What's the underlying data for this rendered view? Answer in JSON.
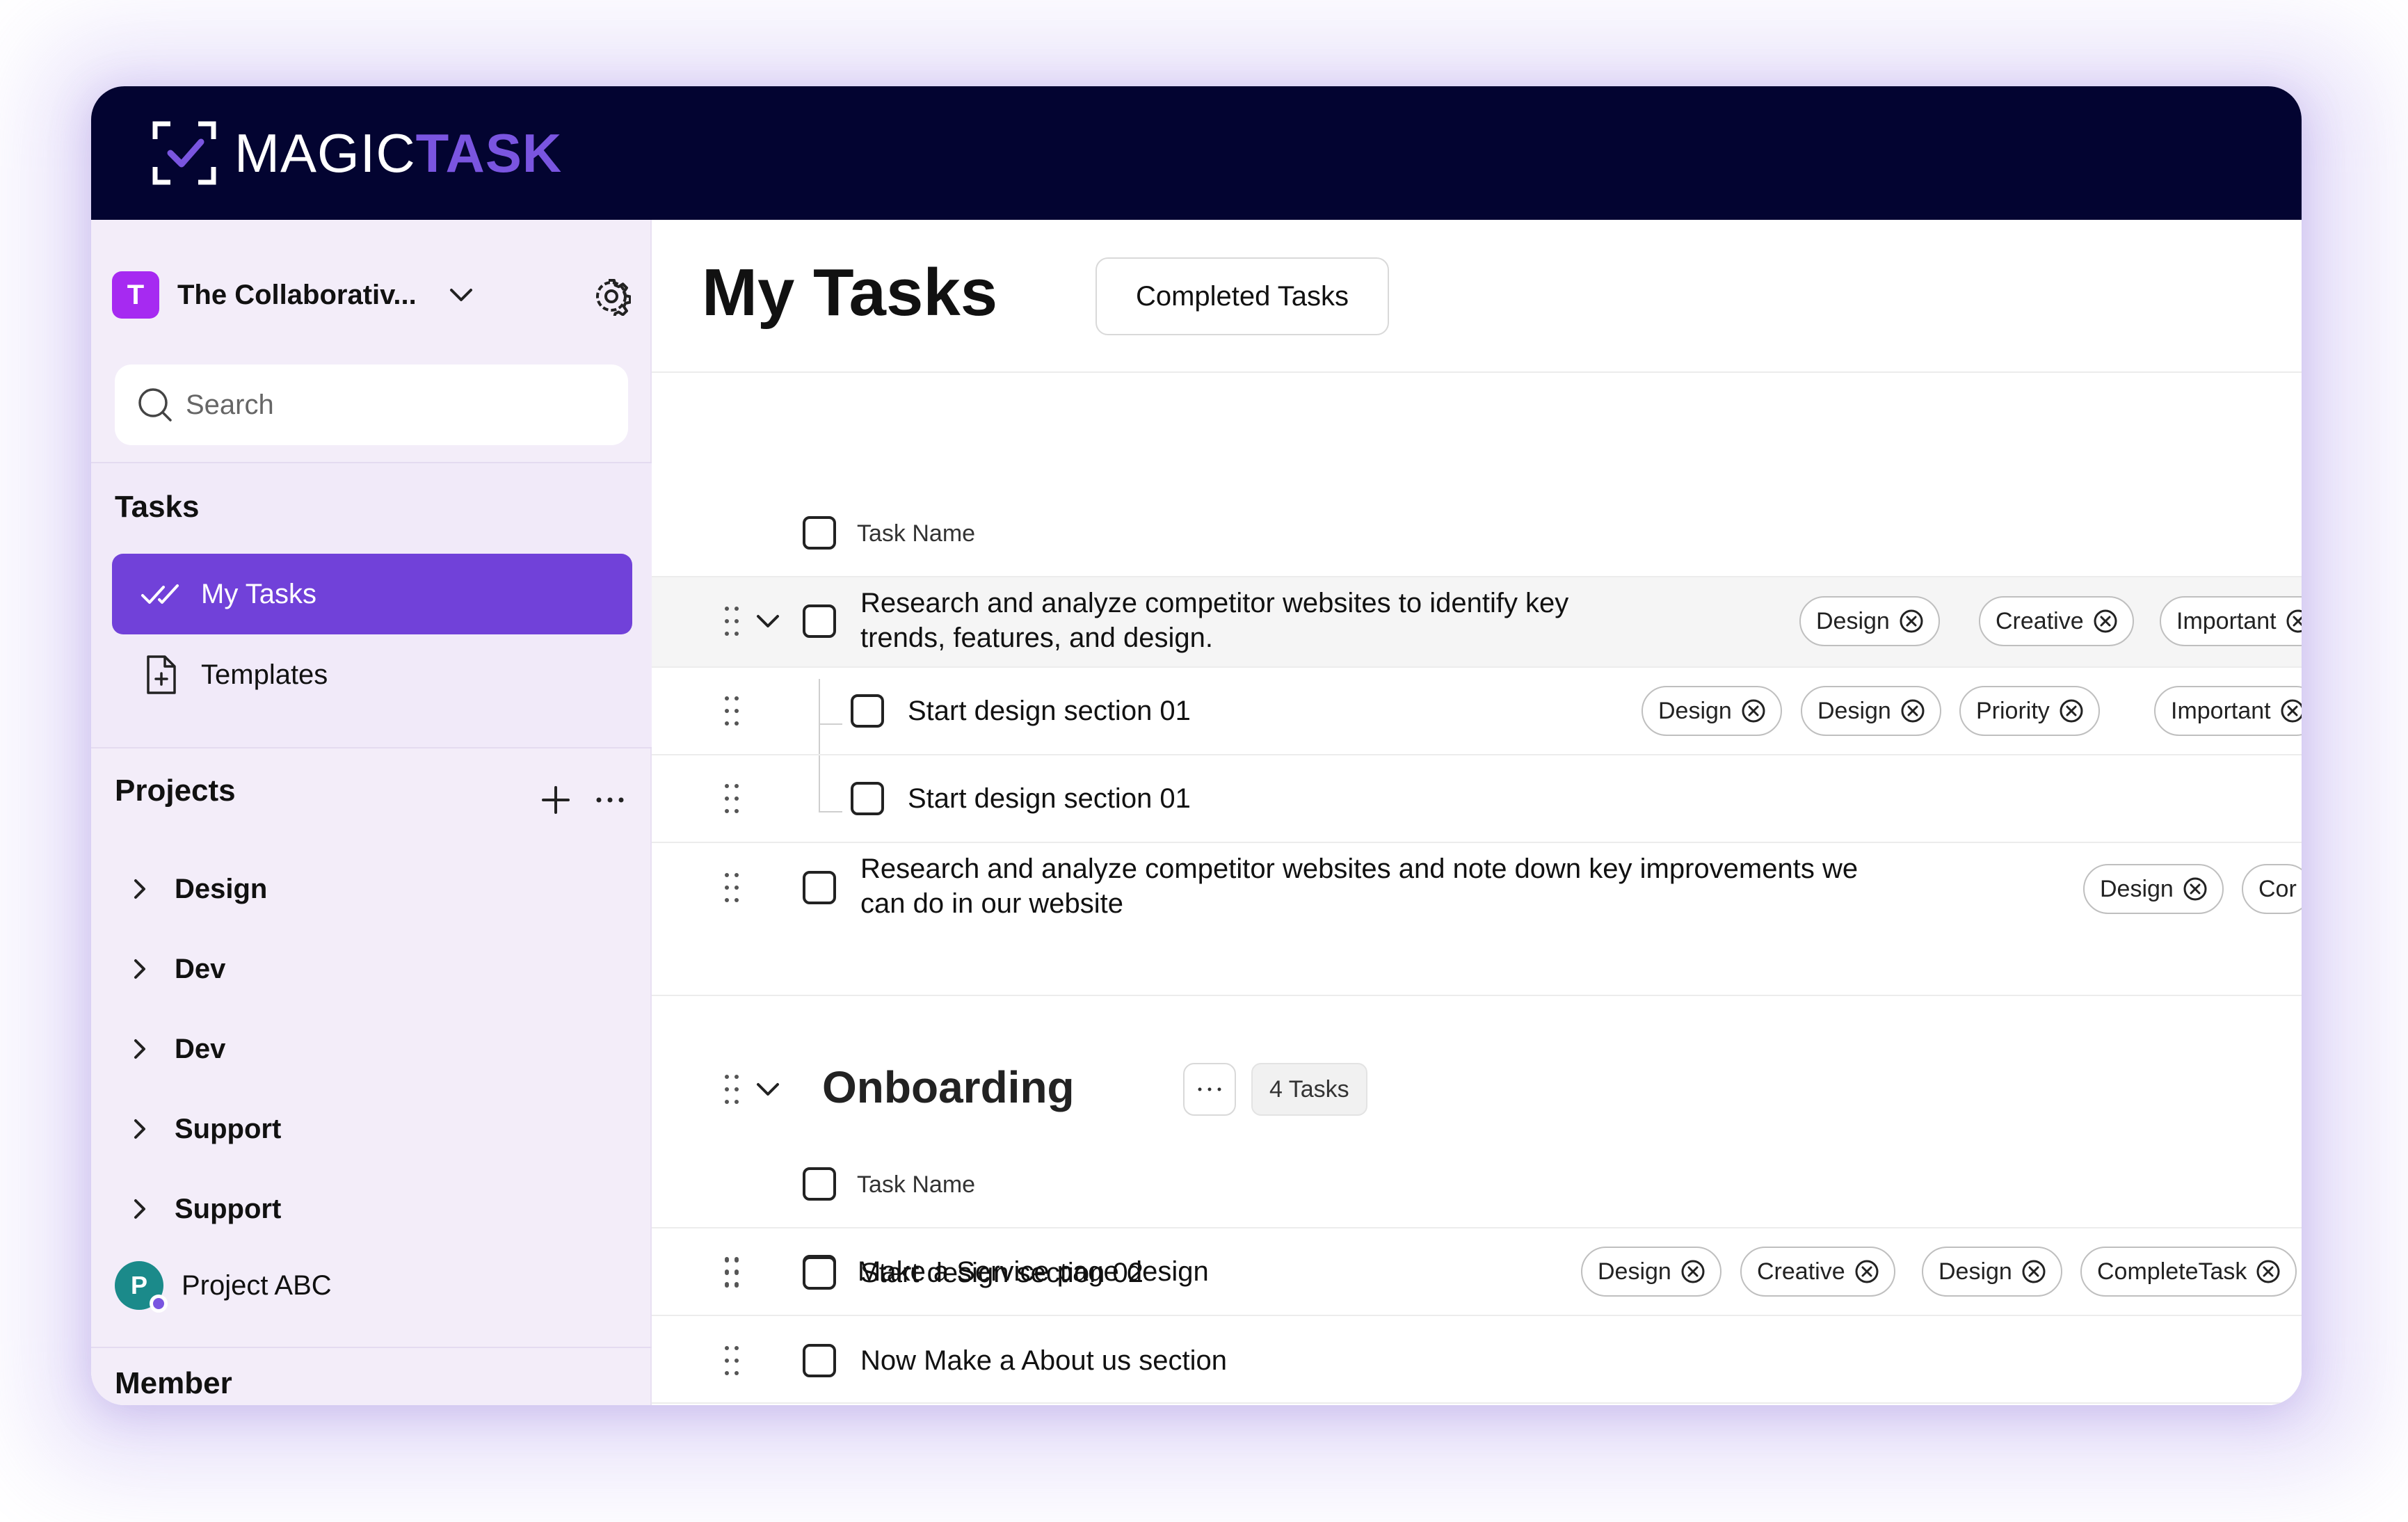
{
  "app": {
    "logo_light": "MAGIC",
    "logo_bold": "TASK"
  },
  "sidebar": {
    "workspace_initial": "T",
    "workspace_name": "The Collaborativ...",
    "search_placeholder": "Search",
    "tasks_heading": "Tasks",
    "nav": [
      {
        "label": "My Tasks",
        "icon": "double-check-icon",
        "active": true
      },
      {
        "label": "Templates",
        "icon": "file-plus-icon",
        "active": false
      }
    ],
    "projects_heading": "Projects",
    "projects": [
      "Design",
      "Dev",
      "Dev",
      "Support",
      "Support"
    ],
    "project_abc": {
      "initial": "P",
      "label": "Project ABC"
    },
    "member_heading": "Member"
  },
  "main": {
    "title": "My Tasks",
    "completed_button": "Completed Tasks",
    "column_header": "Task Name",
    "tasks": [
      {
        "text_line1": "Research and analyze competitor websites to identify key",
        "text_line2": "trends, features, and design.",
        "tags": [
          "Design",
          "Creative",
          "Important"
        ]
      },
      {
        "text": "Start design section 01",
        "tags": [
          "Design",
          "Design",
          "Priority",
          "Important"
        ]
      },
      {
        "text": "Start design section 01",
        "tags": []
      },
      {
        "text_line1": "Research and analyze competitor websites and note down key improvements we",
        "text_line2": "can do in our website",
        "tags": [
          "Design",
          "Cor"
        ]
      }
    ],
    "group": {
      "title": "Onboarding",
      "count": "4 Tasks",
      "column_header": "Task Name",
      "tasks": [
        {
          "text": "Make a Service page design",
          "tags": [
            "Design",
            "Creative",
            "Design",
            "CompleteTask"
          ]
        },
        {
          "text": "Start design section 02",
          "tags": []
        },
        {
          "text": "Now Make a About us section",
          "tags": []
        }
      ]
    }
  },
  "colors": {
    "topbar": "#030431",
    "accent": "#7141d9",
    "sidebar": "#f3edf9",
    "workspace_avatar": "#a62af1"
  }
}
